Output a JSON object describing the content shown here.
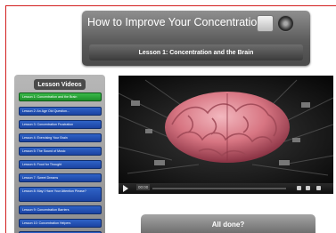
{
  "header": {
    "title": "How to Improve Your Concentration",
    "lesson_title": "Lesson 1: Concentration and the Brain",
    "icons": [
      "app-icon",
      "brain-icon"
    ]
  },
  "sidebar": {
    "title": "Lesson Videos",
    "items": [
      {
        "label": "Lesson 1: Concentration and the Brain",
        "active": true
      },
      {
        "label": "Lesson 2: An Age Old Question..."
      },
      {
        "label": "Lesson 3: Concentration Frustration"
      },
      {
        "label": "Lesson 4: Exercising Your Brain"
      },
      {
        "label": "Lesson 5: The Sound of Music"
      },
      {
        "label": "Lesson 6: Food for Thought"
      },
      {
        "label": "Lesson 7: Sweet Dreams"
      },
      {
        "label": "Lesson 8: May I Have Your Attention Please?"
      },
      {
        "label": "Lesson 9: Concentration Barriers"
      },
      {
        "label": "Lesson 10: Concentration Helpers"
      }
    ]
  },
  "video": {
    "time": "00:00",
    "subject": "brain-image"
  },
  "footer": {
    "done_label": "All done?"
  },
  "colors": {
    "frame": "#d21f1f",
    "lesson_blue": "#1b43a2",
    "lesson_active": "#1d8f2a"
  }
}
